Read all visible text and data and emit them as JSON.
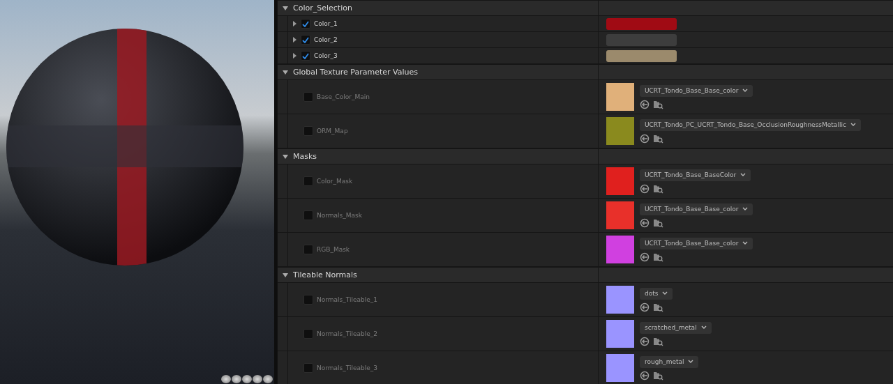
{
  "sections": [
    {
      "title": "Color_Selection",
      "expanded": true,
      "params": [
        {
          "kind": "color",
          "name": "Color_1",
          "checked": true,
          "expanded": false,
          "color": "#a00b14"
        },
        {
          "kind": "color",
          "name": "Color_2",
          "checked": true,
          "expanded": false,
          "color": "#3d3d3d"
        },
        {
          "kind": "color",
          "name": "Color_3",
          "checked": true,
          "expanded": false,
          "color": "#9b8a6c"
        }
      ]
    },
    {
      "title": "Global Texture Parameter Values",
      "expanded": true,
      "params": [
        {
          "kind": "texture",
          "name": "Base_Color_Main",
          "checked": false,
          "asset": "UCRT_Tondo_Base_Base_color",
          "color": "#e0b07a"
        },
        {
          "kind": "texture",
          "name": "ORM_Map",
          "checked": false,
          "asset": "UCRT_Tondo_PC_UCRT_Tondo_Base_OcclusionRoughnessMetallic",
          "color": "#8a8a1e"
        }
      ]
    },
    {
      "title": "Masks",
      "expanded": true,
      "params": [
        {
          "kind": "texture",
          "name": "Color_Mask",
          "checked": false,
          "asset": "UCRT_Tondo_Base_BaseColor",
          "color": "#e0201e"
        },
        {
          "kind": "texture",
          "name": "Normals_Mask",
          "checked": false,
          "asset": "UCRT_Tondo_Base_Base_color",
          "color": "#e8302a"
        },
        {
          "kind": "texture",
          "name": "RGB_Mask",
          "checked": false,
          "asset": "UCRT_Tondo_Base_Base_color",
          "color": "#d040e0"
        }
      ]
    },
    {
      "title": "Tileable Normals",
      "expanded": true,
      "params": [
        {
          "kind": "texture",
          "name": "Normals_Tileable_1",
          "checked": false,
          "asset": "dots",
          "color": "#9a94ff"
        },
        {
          "kind": "texture",
          "name": "Normals_Tileable_2",
          "checked": false,
          "asset": "scratched_metal",
          "color": "#9a94ff"
        },
        {
          "kind": "texture",
          "name": "Normals_Tileable_3",
          "checked": false,
          "asset": "rough_metal",
          "color": "#9a94ff"
        }
      ]
    }
  ]
}
